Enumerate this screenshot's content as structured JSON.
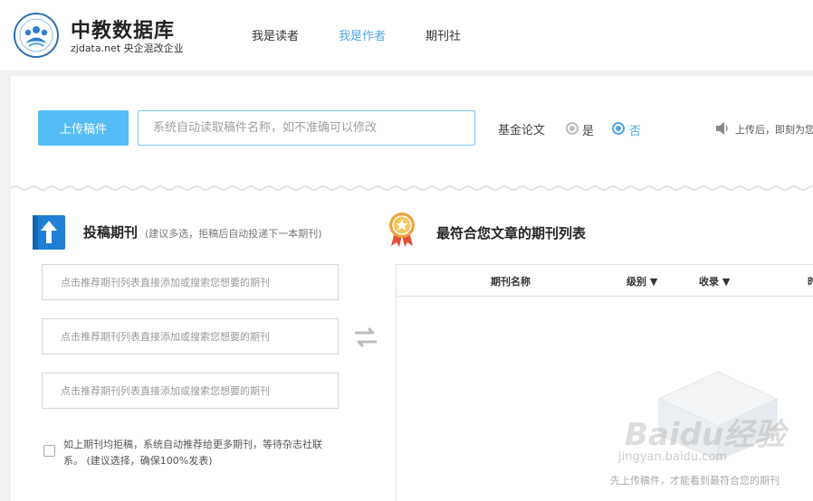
{
  "header": {
    "logo_title": "中教数据库",
    "logo_subtitle": "zjdata.net 央企混改企业",
    "nav": [
      {
        "label": "我是读者",
        "active": false
      },
      {
        "label": "我是作者",
        "active": true
      },
      {
        "label": "期刊社",
        "active": false
      }
    ]
  },
  "upload": {
    "button_label": "上传稿件",
    "title_placeholder": "系统自动读取稿件名称，如不准确可以修改",
    "fund_label": "基金论文",
    "fund_options": [
      {
        "label": "是",
        "checked": false
      },
      {
        "label": "否",
        "checked": true
      }
    ],
    "notice": "上传后，即刻为您"
  },
  "submit": {
    "title": "投稿期刊",
    "hint": "(建议多选，拒稿后自动投递下一本期刊)",
    "journal_placeholders": [
      "点击推荐期刊列表直接添加或搜索您想要的期刊",
      "点击推荐期刊列表直接添加或搜索您想要的期刊",
      "点击推荐期刊列表直接添加或搜索您想要的期刊"
    ],
    "auto_recommend_line1": "如上期刊均拒稿，系统自动推荐给更多期刊，等待杂志社联",
    "auto_recommend_line2": "系。 (建议选择，确保100%发表)"
  },
  "recommend": {
    "title": "最符合您文章的期刊列表",
    "columns": [
      "期刊名称",
      "级别 ▼",
      "收录 ▼",
      "时"
    ],
    "empty_text": "先上传稿件，才能看到最符合您的期刊"
  },
  "watermark": {
    "brand": "Baidu经验",
    "domain": "jingyan.baidu.com"
  },
  "colors": {
    "accent": "#4fa6e6",
    "button": "#55bdf5",
    "icon_blue": "#1e7fd4",
    "badge_orange": "#f2a23a",
    "badge_red": "#e0523a"
  }
}
